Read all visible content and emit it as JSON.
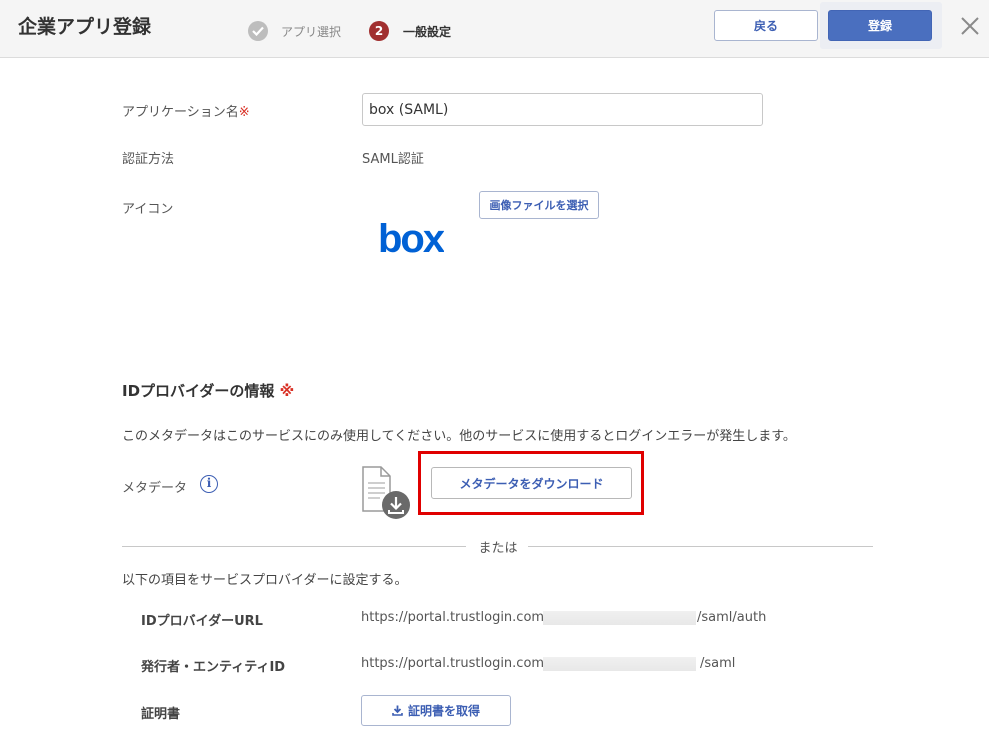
{
  "header": {
    "title": "企業アプリ登録",
    "step1_label": "アプリ選択",
    "step2_number": "2",
    "step2_label": "一般設定",
    "back_label": "戻る",
    "register_label": "登録"
  },
  "form": {
    "app_name_label": "アプリケーション名",
    "required_mark": "※",
    "app_name_value": "box (SAML)",
    "auth_method_label": "認証方法",
    "auth_method_value": "SAML認証",
    "icon_label": "アイコン",
    "select_image_label": "画像ファイルを選択",
    "logo_text": "box"
  },
  "idp": {
    "section_title": "IDプロバイダーの情報",
    "required_mark": "※",
    "note": "このメタデータはこのサービスにのみ使用してください。他のサービスに使用するとログインエラーが発生します。",
    "metadata_label": "メタデータ",
    "info_glyph": "i",
    "download_metadata_label": "メタデータをダウンロード",
    "or_text": "または",
    "set_note": "以下の項目をサービスプロバイダーに設定する。",
    "idp_url_label": "IDプロバイダーURL",
    "idp_url_prefix": "https://portal.trustlogin.com/",
    "idp_url_suffix": "/saml/auth",
    "issuer_label": "発行者・エンティティID",
    "issuer_prefix": "https://portal.trustlogin.com/",
    "issuer_suffix": "/saml",
    "cert_label": "証明書",
    "get_cert_label": "証明書を取得"
  },
  "colors": {
    "accent": "#3c5eb3",
    "primary_button": "#4a6fbf",
    "required": "#d93025",
    "highlight": "#e00000",
    "step_active": "#a12f2f",
    "box_brand": "#0061d5"
  }
}
